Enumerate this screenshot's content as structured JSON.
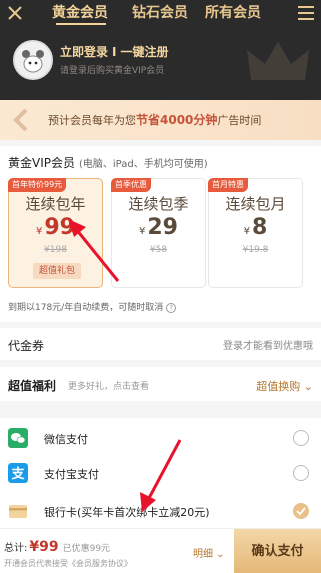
{
  "header": {
    "tabs": [
      "黄金会员",
      "钻石会员",
      "所有会员"
    ],
    "login_text": "立即登录",
    "separator": "I",
    "register_text": "一键注册",
    "login_sub": "请登录后购买黄金VIP会员"
  },
  "banner": {
    "prefix": "预计会员每年为您",
    "highlight": "节省4000分钟",
    "suffix": "广告时间"
  },
  "vip": {
    "title": "黄金VIP会员",
    "subtitle": "(电脑、iPad、手机均可使用)",
    "plans": [
      {
        "tag": "首年特价99元",
        "name": "连续包年",
        "currency": "¥",
        "price": "99",
        "original": "¥198",
        "gift": "超值礼包",
        "selected": true
      },
      {
        "tag": "首季优惠",
        "name": "连续包季",
        "currency": "¥",
        "price": "29",
        "original": "¥58",
        "selected": false
      },
      {
        "tag": "首月特惠",
        "name": "连续包月",
        "currency": "¥",
        "price": "8",
        "original": "¥19.8",
        "selected": false
      }
    ],
    "renew_note": "到期以178元/年自动续费，可随时取消",
    "renew_q": "?"
  },
  "coupon": {
    "label": "代金券",
    "hint": "登录才能看到优惠哦"
  },
  "welfare": {
    "label": "超值福利",
    "hint": "更多好礼，点击查看",
    "action": "超值换购 ⌄"
  },
  "payments": [
    {
      "label": "微信支付",
      "icon": "wechat-icon",
      "color": "#2aae67",
      "selected": false
    },
    {
      "label": "支付宝支付",
      "icon": "alipay-icon",
      "color": "#1a9ce8",
      "selected": false
    },
    {
      "label": "银行卡(买年卡首次绑卡立减20元)",
      "icon": "bank-card-icon",
      "color": "#e9c08a",
      "selected": true
    }
  ],
  "bottom": {
    "total_label": "总计:",
    "currency": "¥",
    "total": "99",
    "discount": "已优惠99元",
    "agreement": "开通会员代表接受《会员服务协议》",
    "detail": "明细 ⌄",
    "confirm": "确认支付"
  },
  "colors": {
    "accent": "#e9c08a",
    "price": "#c0392b",
    "header_bg": "#2b2b2b",
    "arrow": "#e8132b"
  }
}
